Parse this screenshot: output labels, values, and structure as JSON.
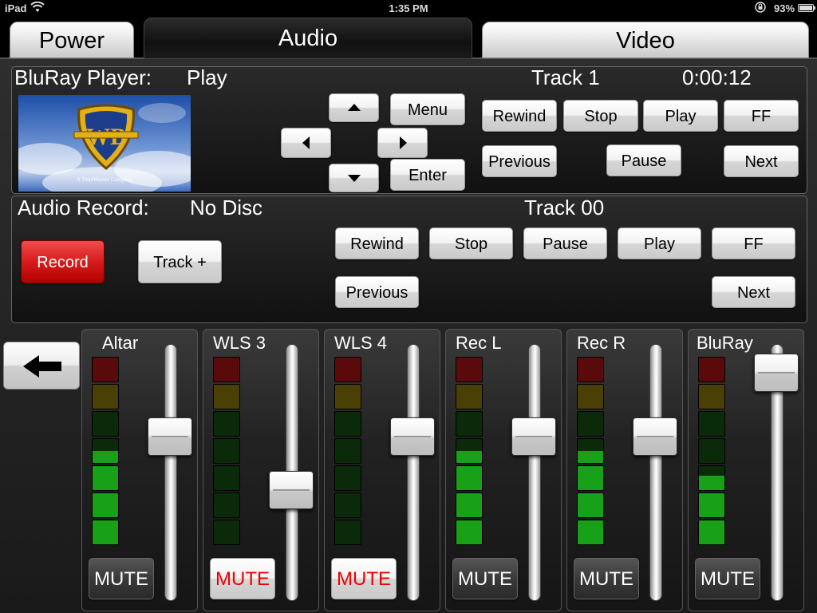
{
  "status_bar": {
    "device": "iPad",
    "time": "1:35 PM",
    "battery": "93%",
    "battery_level": 0.93
  },
  "tabs": [
    {
      "label": "Power",
      "active": false
    },
    {
      "label": "Audio",
      "active": true
    },
    {
      "label": "Video",
      "active": false
    }
  ],
  "bluray": {
    "title": "BluRay Player:",
    "state": "Play",
    "track": "Track 1",
    "time": "0:00:12",
    "thumbnail_caption": "A TimeWarner Company",
    "nav": {
      "menu": "Menu",
      "enter": "Enter"
    },
    "transport": {
      "rewind": "Rewind",
      "stop": "Stop",
      "play": "Play",
      "ff": "FF",
      "previous": "Previous",
      "pause": "Pause",
      "next": "Next"
    }
  },
  "recorder": {
    "title": "Audio Record:",
    "state": "No Disc",
    "track": "Track 00",
    "record": "Record",
    "track_plus": "Track +",
    "transport": {
      "rewind": "Rewind",
      "stop": "Stop",
      "pause": "Pause",
      "play": "Play",
      "ff": "FF",
      "previous": "Previous",
      "next": "Next"
    }
  },
  "mixer": {
    "mute_label": "MUTE",
    "colors": {
      "red": "#5a0a0a",
      "yellow": "#4a3f05",
      "green_off": "#0a2a0a",
      "green_on": "#18a018"
    },
    "channels": [
      {
        "name": "Altar",
        "muted": false,
        "fader_level": 0.62,
        "meter_level": 3.5
      },
      {
        "name": "WLS 3",
        "muted": true,
        "fader_level": 0.3,
        "meter_level": 0
      },
      {
        "name": "WLS 4",
        "muted": true,
        "fader_level": 0.62,
        "meter_level": 0
      },
      {
        "name": "Rec L",
        "muted": false,
        "fader_level": 0.62,
        "meter_level": 3.5
      },
      {
        "name": "Rec R",
        "muted": false,
        "fader_level": 0.62,
        "meter_level": 3.5
      },
      {
        "name": "BluRay",
        "muted": false,
        "fader_level": 1.0,
        "meter_level": 2.6
      }
    ]
  }
}
